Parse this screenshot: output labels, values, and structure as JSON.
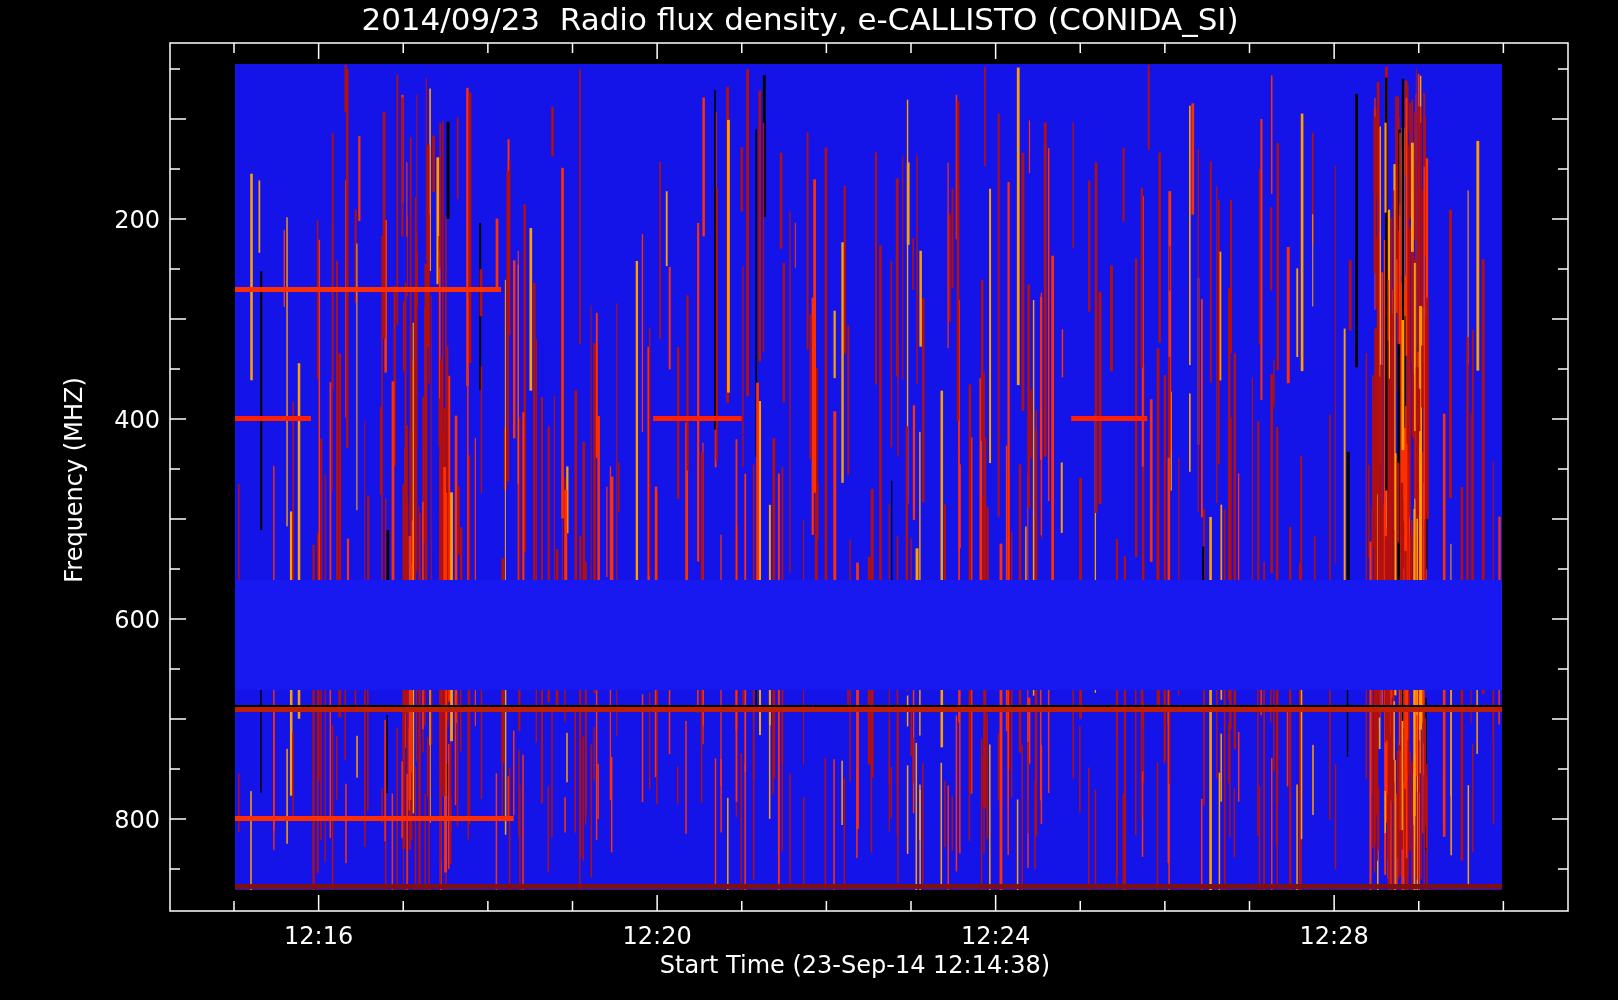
{
  "plot": {
    "title": "2014/09/23  Radio flux density, e-CALLISTO (CONIDA_SI)",
    "x_axis": {
      "label": "Start Time (23-Sep-14 12:14:38)",
      "ticks": [
        "12:16",
        "12:20",
        "12:24",
        "12:28"
      ]
    },
    "y_axis": {
      "label": "Frequency (MHZ)",
      "ticks": [
        "200",
        "400",
        "600",
        "800"
      ]
    }
  }
}
